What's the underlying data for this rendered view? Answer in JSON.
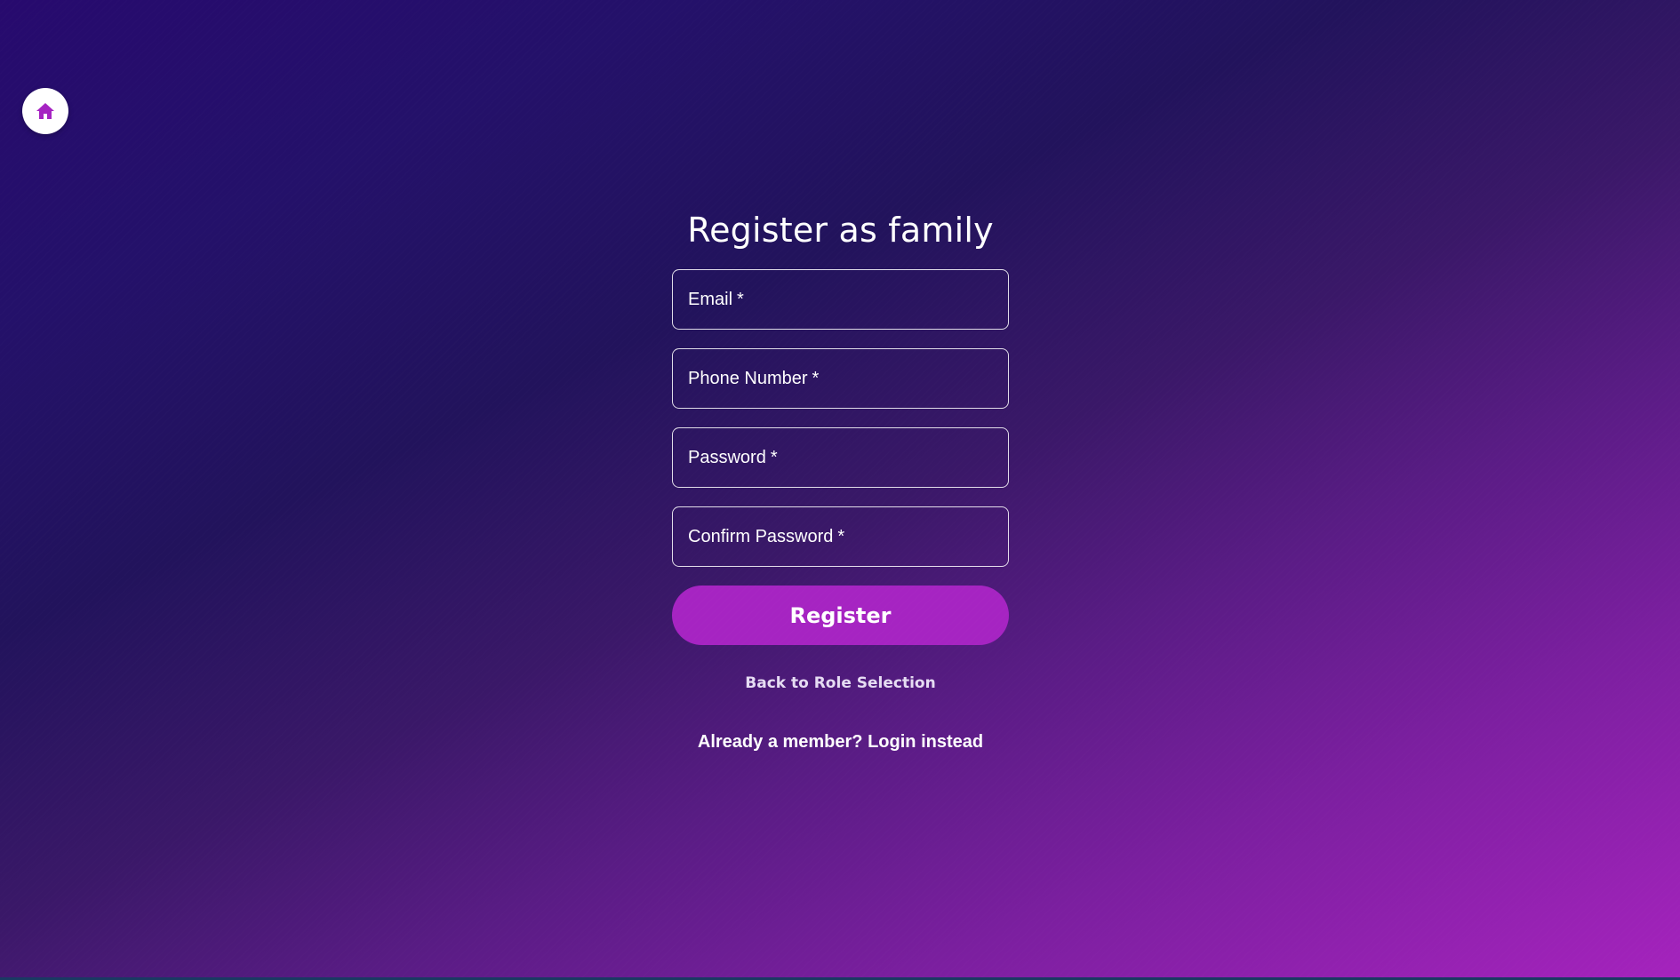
{
  "navigation": {
    "home_icon": "home-icon"
  },
  "page": {
    "title": "Register as family"
  },
  "form": {
    "fields": [
      {
        "label": "Email",
        "required_marker": "*"
      },
      {
        "label": "Phone Number",
        "required_marker": "*"
      },
      {
        "label": "Password",
        "required_marker": "*"
      },
      {
        "label": "Confirm Password",
        "required_marker": "*"
      }
    ],
    "submit_label": "Register"
  },
  "links": {
    "back_label": "Back to Role Selection",
    "login_label": "Already a member? Login instead"
  },
  "colors": {
    "accent": "#a624c2",
    "gradient_start": "#270a6e",
    "gradient_end": "#a523bd",
    "text": "#ffffff"
  }
}
